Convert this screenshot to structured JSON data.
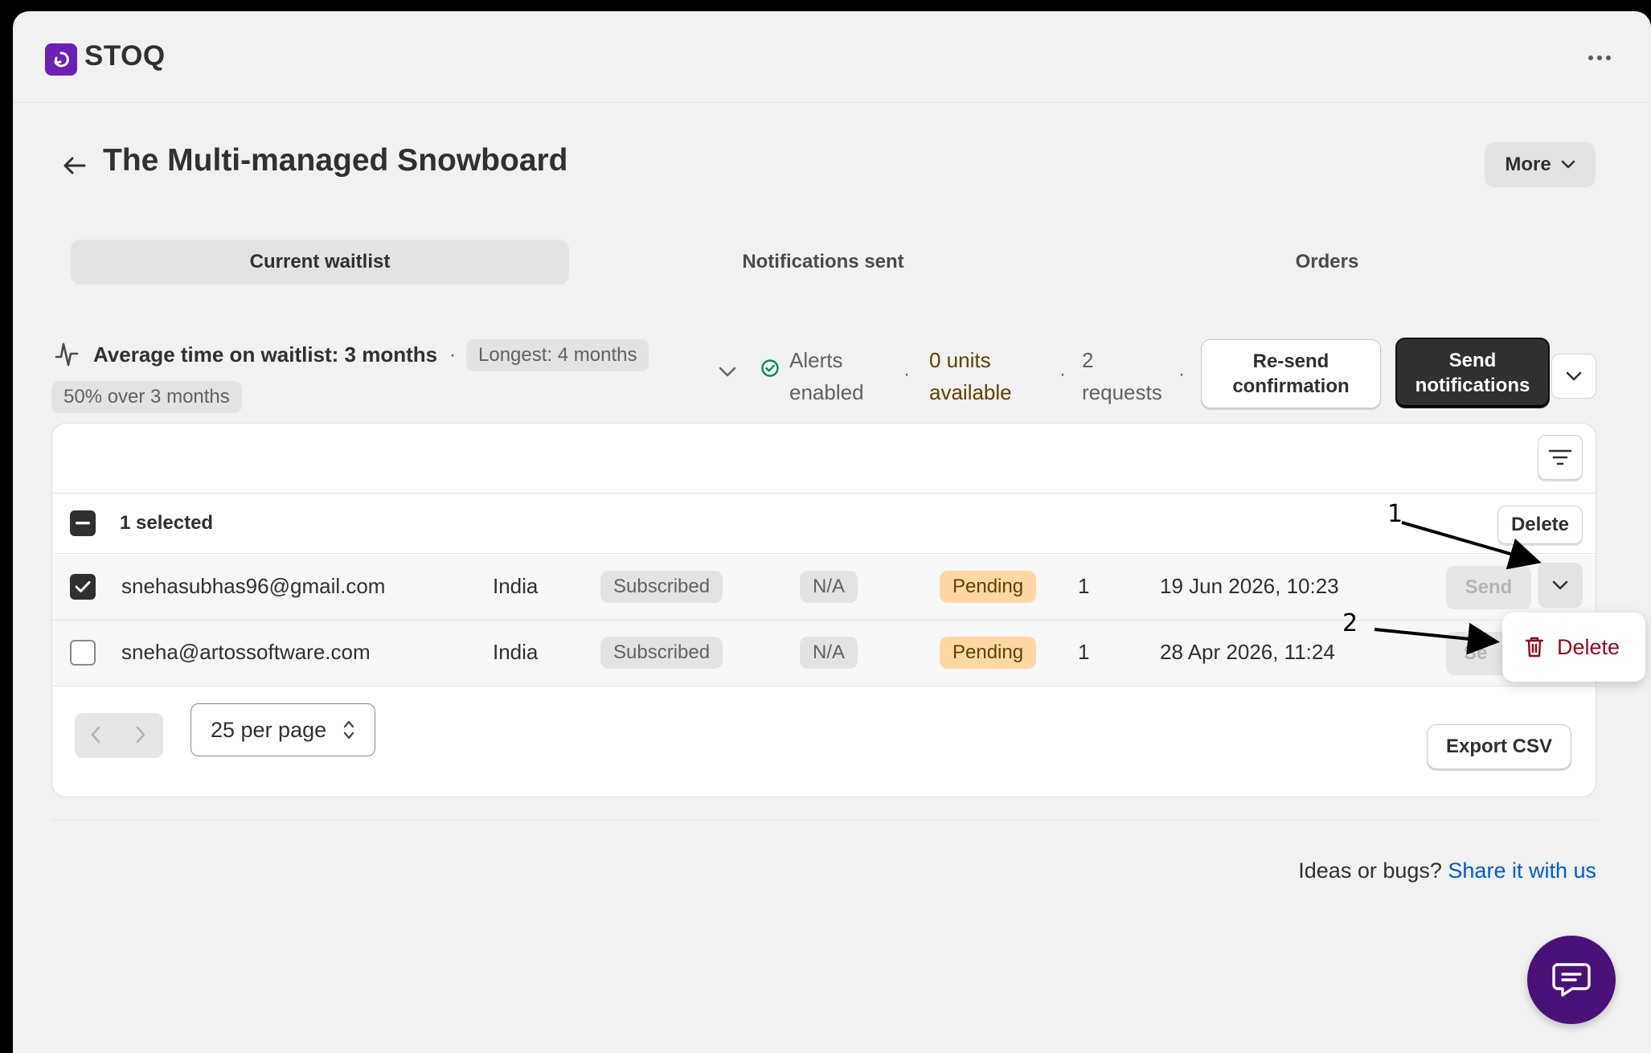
{
  "app": {
    "brand": "STOQ"
  },
  "page": {
    "title": "The Multi-managed Snowboard",
    "more_label": "More"
  },
  "tabs": [
    {
      "label": "Current waitlist",
      "active": true
    },
    {
      "label": "Notifications sent",
      "active": false
    },
    {
      "label": "Orders",
      "active": false
    }
  ],
  "stats": {
    "avg": "Average time on waitlist: 3 months",
    "longest": "Longest: 4 months",
    "over": "50% over 3 months",
    "alerts_l1": "Alerts",
    "alerts_l2": "enabled",
    "units_l1": "0 units",
    "units_l2": "available",
    "requests_l1": "2",
    "requests_l2": "requests",
    "separator": "·"
  },
  "actions": {
    "resend_l1": "Re-send",
    "resend_l2": "confirmation",
    "send_l1": "Send",
    "send_l2": "notifications"
  },
  "table": {
    "selected_label": "1 selected",
    "delete_label": "Delete",
    "rows": [
      {
        "email": "snehasubhas96@gmail.com",
        "country": "India",
        "status": "Subscribed",
        "variant": "N/A",
        "notification": "Pending",
        "quantity": "1",
        "date": "19 Jun 2026, 10:23",
        "action": "Send",
        "checked": true
      },
      {
        "email": "sneha@artossoftware.com",
        "country": "India",
        "status": "Subscribed",
        "variant": "N/A",
        "notification": "Pending",
        "quantity": "1",
        "date": "28 Apr 2026, 11:24",
        "action": "Se",
        "checked": false
      }
    ],
    "per_page": "25 per page",
    "export_label": "Export CSV"
  },
  "popover": {
    "delete_label": "Delete"
  },
  "footer": {
    "prefix": "Ideas or bugs?",
    "link": "Share it with us"
  },
  "annotations": {
    "one": "1",
    "two": "2"
  },
  "colors": {
    "brand": "#6b1fb4",
    "chat": "#4a1179",
    "danger": "#8e0b21",
    "link": "#005bd3",
    "pending": "#ffd6a4"
  }
}
